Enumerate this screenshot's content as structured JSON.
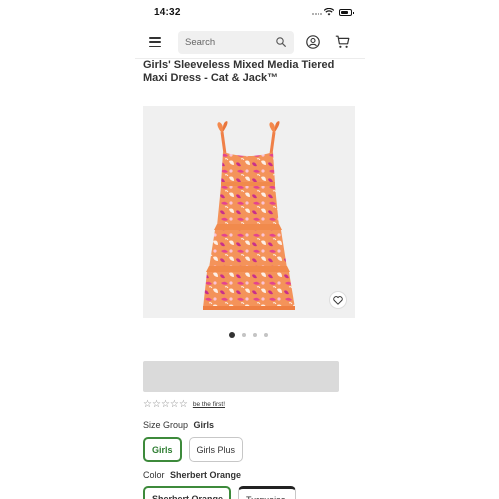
{
  "status_bar": {
    "time": "14:32"
  },
  "header": {
    "search": {
      "placeholder": "Search"
    }
  },
  "product": {
    "title": "Girls' Sleeveless Mixed Media Tiered Maxi Dress - Cat & Jack™",
    "image_alt": "pink orange tropical print tiered maxi dress",
    "carousel": {
      "count": 4,
      "active_index": 0
    }
  },
  "rating": {
    "stars": [
      "☆",
      "☆",
      "☆",
      "☆",
      "☆"
    ],
    "link_text": "be the first!"
  },
  "size_group": {
    "label": "Size Group",
    "selected_value": "Girls",
    "options": [
      "Girls",
      "Girls Plus"
    ]
  },
  "color": {
    "label": "Color",
    "selected_value": "Sherbert Orange",
    "options": [
      "Sherbert Orange",
      "Turquoise"
    ]
  },
  "colors": {
    "selected_border": "#3d8a3b",
    "placeholder_bar": "#dadada",
    "image_bg": "#f0f0f0",
    "dress_base": "#f4935a",
    "dress_print": "#e3448f"
  },
  "icons": {
    "menu": "menu-icon",
    "search": "search-icon",
    "account": "account-icon",
    "cart": "cart-icon",
    "favorite": "heart-icon"
  }
}
